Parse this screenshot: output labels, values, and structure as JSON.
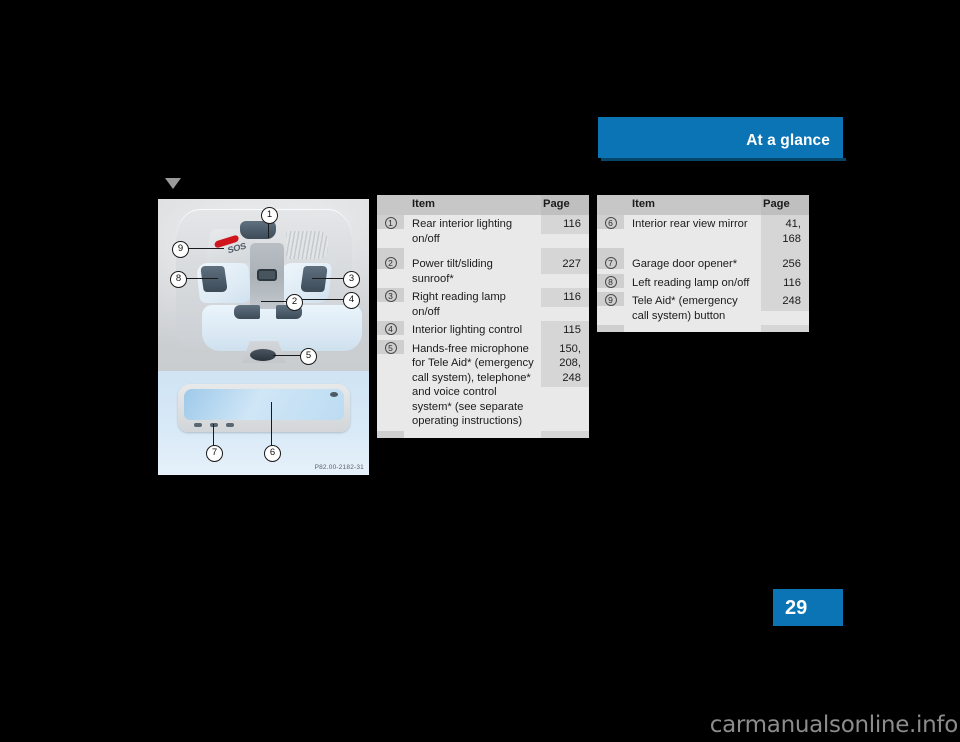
{
  "header": {
    "title": "At a glance"
  },
  "page_tab": {
    "number": "29"
  },
  "figure": {
    "caption": "P82.00-2182-31",
    "sos_label": "SOS",
    "callouts": [
      "1",
      "2",
      "3",
      "4",
      "5",
      "6",
      "7",
      "8",
      "9"
    ]
  },
  "tables": [
    {
      "id": "table-overhead-console-left",
      "columns": {
        "item": "Item",
        "page": "Page"
      },
      "rows": [
        {
          "num": "1",
          "item": "Rear interior lighting on/off",
          "page": "116"
        },
        {
          "num": "2",
          "item": "Power tilt/sliding sunroof*",
          "page": "227"
        },
        {
          "num": "3",
          "item": "Right reading lamp on/off",
          "page": "116"
        },
        {
          "num": "4",
          "item": "Interior lighting control",
          "page": "115"
        },
        {
          "num": "5",
          "item": "Hands-free microphone for Tele Aid* (emergency call system), telephone* and voice control system* (see separate operating instructions)",
          "page": "150,\n208,\n248"
        }
      ]
    },
    {
      "id": "table-overhead-console-right",
      "columns": {
        "item": "Item",
        "page": "Page"
      },
      "rows": [
        {
          "num": "6",
          "item": "Interior rear view mirror",
          "page": "41,\n168"
        },
        {
          "num": "7",
          "item": "Garage door opener*",
          "page": "256"
        },
        {
          "num": "8",
          "item": "Left reading lamp on/off",
          "page": "116"
        },
        {
          "num": "9",
          "item": "Tele Aid* (emergency call system) button",
          "page": "248"
        }
      ]
    }
  ],
  "watermark": {
    "text": "carmanualsonline.info"
  },
  "colors": {
    "accent": "#0a74b4",
    "header_text": "#ffffff",
    "table_head_bg": "#c7c7c7",
    "table_body_bg": "#e9e9e9"
  }
}
